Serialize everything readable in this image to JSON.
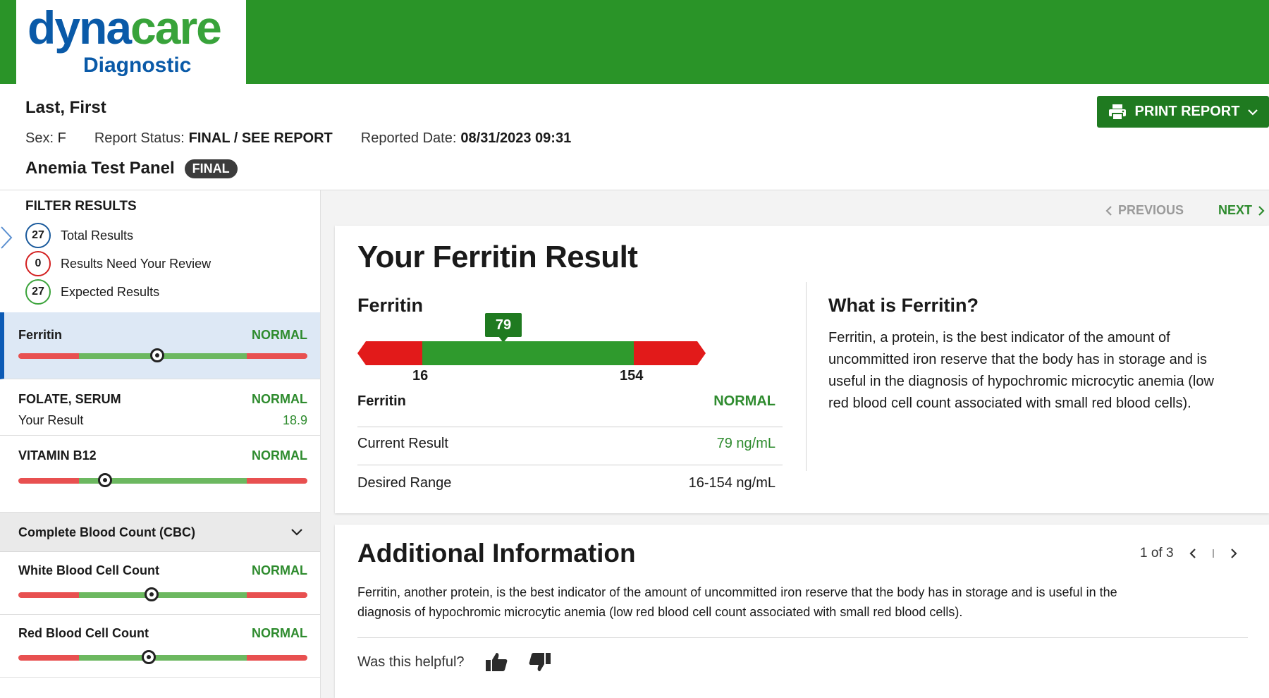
{
  "brand": {
    "word_a": "dyna",
    "word_b": "care",
    "sub": "Diagnostic",
    "colors": {
      "header_green": "#2a9428",
      "brand_blue": "#0a5aa8",
      "status_green": "#2e8b2e",
      "alert_red": "#e21a1a"
    }
  },
  "patient": {
    "name": "Last, First",
    "sex_label": "Sex:",
    "sex_value": "F",
    "status_label": "Report Status:",
    "status_value": "FINAL / SEE REPORT",
    "date_label": "Reported Date:",
    "date_value": "08/31/2023 09:31",
    "panel_title": "Anemia Test Panel",
    "panel_badge": "FINAL"
  },
  "toolbar": {
    "print_label": "PRINT REPORT",
    "print_icon": "printer-icon"
  },
  "filters": {
    "heading": "FILTER RESULTS",
    "items": [
      {
        "count": "27",
        "label": "Total Results"
      },
      {
        "count": "0",
        "label": "Results Need Your Review"
      },
      {
        "count": "27",
        "label": "Expected Results"
      }
    ]
  },
  "sidebar": {
    "tests": [
      {
        "name": "Ferritin",
        "status": "NORMAL",
        "marker_fraction": 0.48
      },
      {
        "name": "FOLATE, SERUM",
        "status": "NORMAL",
        "sub_label": "Your Result",
        "sub_value": "18.9"
      },
      {
        "name": "VITAMIN B12",
        "status": "NORMAL",
        "marker_fraction": 0.3
      }
    ],
    "cbc_group": "Complete Blood Count (CBC)",
    "cbc_tests": [
      {
        "name": "White Blood Cell Count",
        "status": "NORMAL",
        "marker_fraction": 0.46
      },
      {
        "name": "Red Blood Cell Count",
        "status": "NORMAL",
        "marker_fraction": 0.45
      }
    ]
  },
  "pager": {
    "previous": "PREVIOUS",
    "next": "NEXT"
  },
  "result": {
    "heading": "Your Ferritin Result",
    "test_name": "Ferritin",
    "marker_value": "79",
    "range_low": "16",
    "range_high": "154",
    "row_name": "Ferritin",
    "row_status": "NORMAL",
    "current_label": "Current Result",
    "current_value": "79 ng/mL",
    "desired_label": "Desired Range",
    "desired_value": "16-154 ng/mL"
  },
  "what_is": {
    "title": "What is Ferritin?",
    "text": "Ferritin, a protein, is the best indicator of the amount of uncommitted iron reserve that the body has in storage and is useful in the diagnosis of hypochromic microcytic anemia (low red blood cell count associated with small red blood cells)."
  },
  "additional": {
    "title": "Additional Information",
    "page_indicator": "1 of 3",
    "text": "Ferritin, another protein, is the best indicator of the amount of uncommitted iron reserve that the body has in storage and is useful in the diagnosis of hypochromic microcytic anemia (low red blood cell count associated with small red blood cells).",
    "helpful_label": "Was this helpful?"
  }
}
